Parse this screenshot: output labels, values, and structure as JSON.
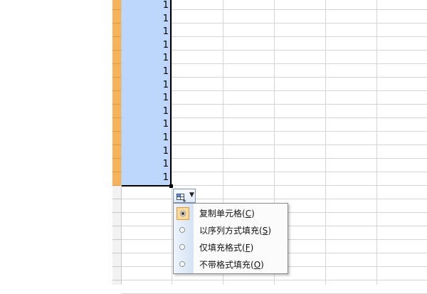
{
  "sheet": {
    "selected_values": [
      "1",
      "1",
      "1",
      "1",
      "1",
      "1",
      "1",
      "1",
      "1",
      "1",
      "1",
      "1",
      "1",
      "1"
    ]
  },
  "autofill": {
    "button_icon": "autofill-options-icon",
    "dropdown_icon": "chevron-down-icon",
    "options": [
      {
        "label": "复制单元格(",
        "key": "C",
        "tail": ")",
        "checked": true
      },
      {
        "label": "以序列方式填充(",
        "key": "S",
        "tail": ")",
        "checked": false
      },
      {
        "label": "仅填充格式(",
        "key": "F",
        "tail": ")",
        "checked": false
      },
      {
        "label": "不带格式填充(",
        "key": "O",
        "tail": ")",
        "checked": false
      }
    ]
  },
  "colors": {
    "selection_fill": "#bcd7fb",
    "row_header_selected": "#f6b45a",
    "menu_check_bg": "#fbd89b"
  }
}
